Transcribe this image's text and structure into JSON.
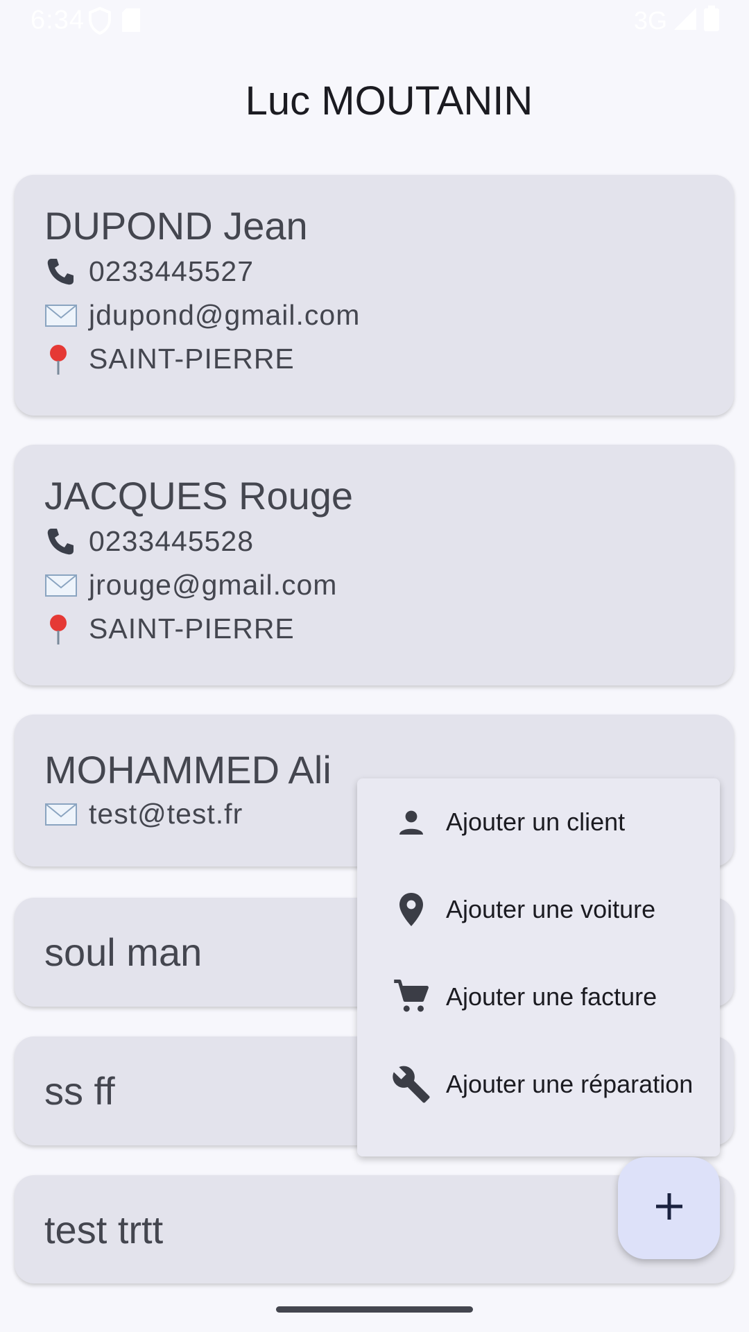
{
  "status_bar": {
    "time": "6:34",
    "network": "3G"
  },
  "header": {
    "title": "Luc MOUTANIN"
  },
  "clients": [
    {
      "name": "DUPOND Jean",
      "phone": "0233445527",
      "email": "jdupond@gmail.com",
      "city": "SAINT-PIERRE"
    },
    {
      "name": "JACQUES Rouge",
      "phone": "0233445528",
      "email": "jrouge@gmail.com",
      "city": "SAINT-PIERRE"
    },
    {
      "name": "MOHAMMED Ali",
      "email": "test@test.fr"
    },
    {
      "name": "soul man"
    },
    {
      "name": "ss ff"
    },
    {
      "name": "test trtt"
    }
  ],
  "menu": {
    "items": [
      {
        "label": "Ajouter un client",
        "icon": "person-icon"
      },
      {
        "label": "Ajouter une voiture",
        "icon": "location-pin-icon"
      },
      {
        "label": "Ajouter une facture",
        "icon": "cart-icon"
      },
      {
        "label": "Ajouter une réparation",
        "icon": "wrench-icon"
      }
    ]
  },
  "fab": {
    "icon": "plus-icon"
  },
  "colors": {
    "background": "#f7f7fc",
    "card": "#e3e3ec",
    "menu": "#e9e9f2",
    "fab": "#dde1f9",
    "text": "#44464f"
  }
}
